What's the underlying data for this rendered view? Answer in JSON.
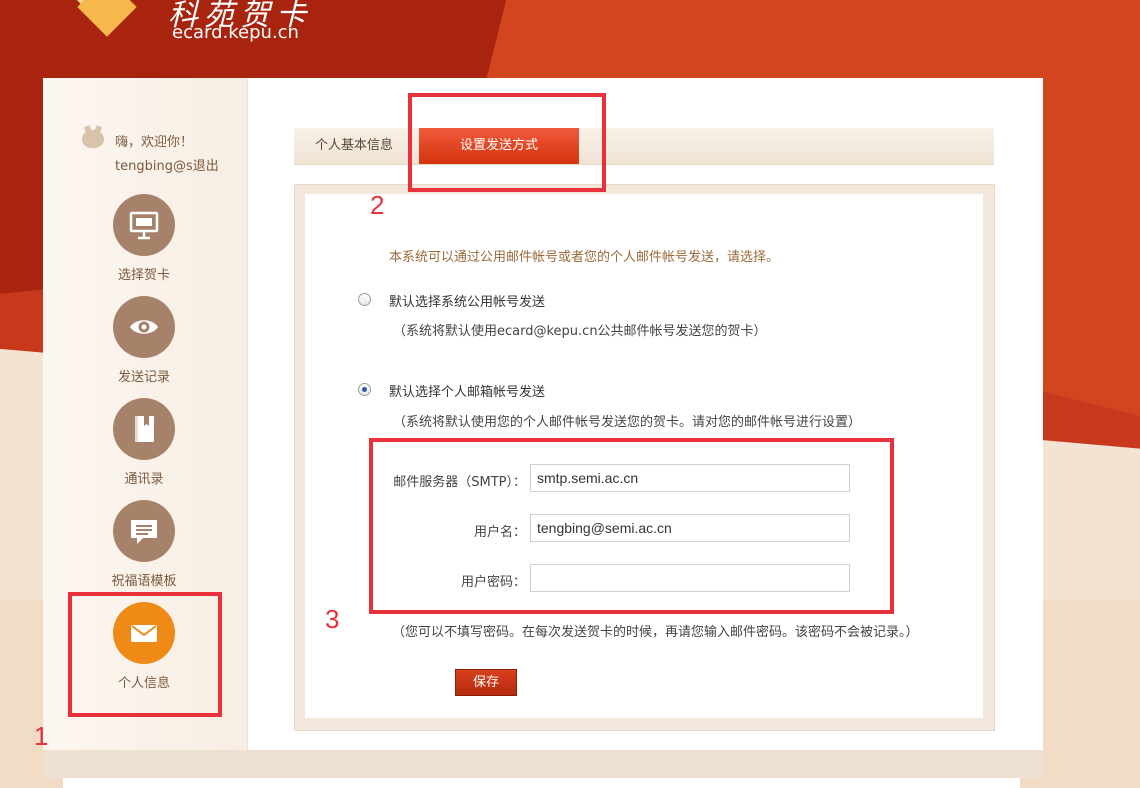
{
  "site": {
    "title": "科苑贺卡",
    "domain": "ecard.kepu.cn"
  },
  "user": {
    "greeting": "嗨，欢迎你！",
    "username": "tengbing@s",
    "logout": "退出"
  },
  "sidebar": {
    "items": [
      {
        "label": "选择贺卡",
        "icon": "easel-icon"
      },
      {
        "label": "发送记录",
        "icon": "eye-icon"
      },
      {
        "label": "通讯录",
        "icon": "address-book-icon"
      },
      {
        "label": "祝福语模板",
        "icon": "chat-bubble-icon"
      },
      {
        "label": "个人信息",
        "icon": "envelope-icon",
        "active": true
      }
    ]
  },
  "tabs": {
    "basic": "个人基本信息",
    "send": "设置发送方式"
  },
  "form": {
    "intro": "本系统可以通过公用邮件帐号或者您的个人邮件帐号发送，请选择。",
    "option_public": {
      "label": "默认选择系统公用帐号发送",
      "note": "（系统将默认使用ecard@kepu.cn公共邮件帐号发送您的贺卡）",
      "checked": false
    },
    "option_personal": {
      "label": "默认选择个人邮箱帐号发送",
      "note": "（系统将默认使用您的个人邮件帐号发送您的贺卡。请对您的邮件帐号进行设置）",
      "checked": true
    },
    "smtp_label": "邮件服务器（SMTP）：",
    "smtp_value": "smtp.semi.ac.cn",
    "username_label": "用户名：",
    "username_value": "tengbing@semi.ac.cn",
    "password_label": "用户密码：",
    "password_value": "",
    "password_note": "（您可以不填写密码。在每次发送贺卡的时候，再请您输入邮件密码。该密码不会被记录。）",
    "save_label": "保存"
  },
  "annotations": {
    "n1": "1",
    "n2": "2",
    "n3": "3",
    "color": "#e8313a"
  },
  "colors": {
    "brand_red": "#c7381c",
    "accent_orange": "#f08a16",
    "nav_brown": "#a7826a"
  }
}
